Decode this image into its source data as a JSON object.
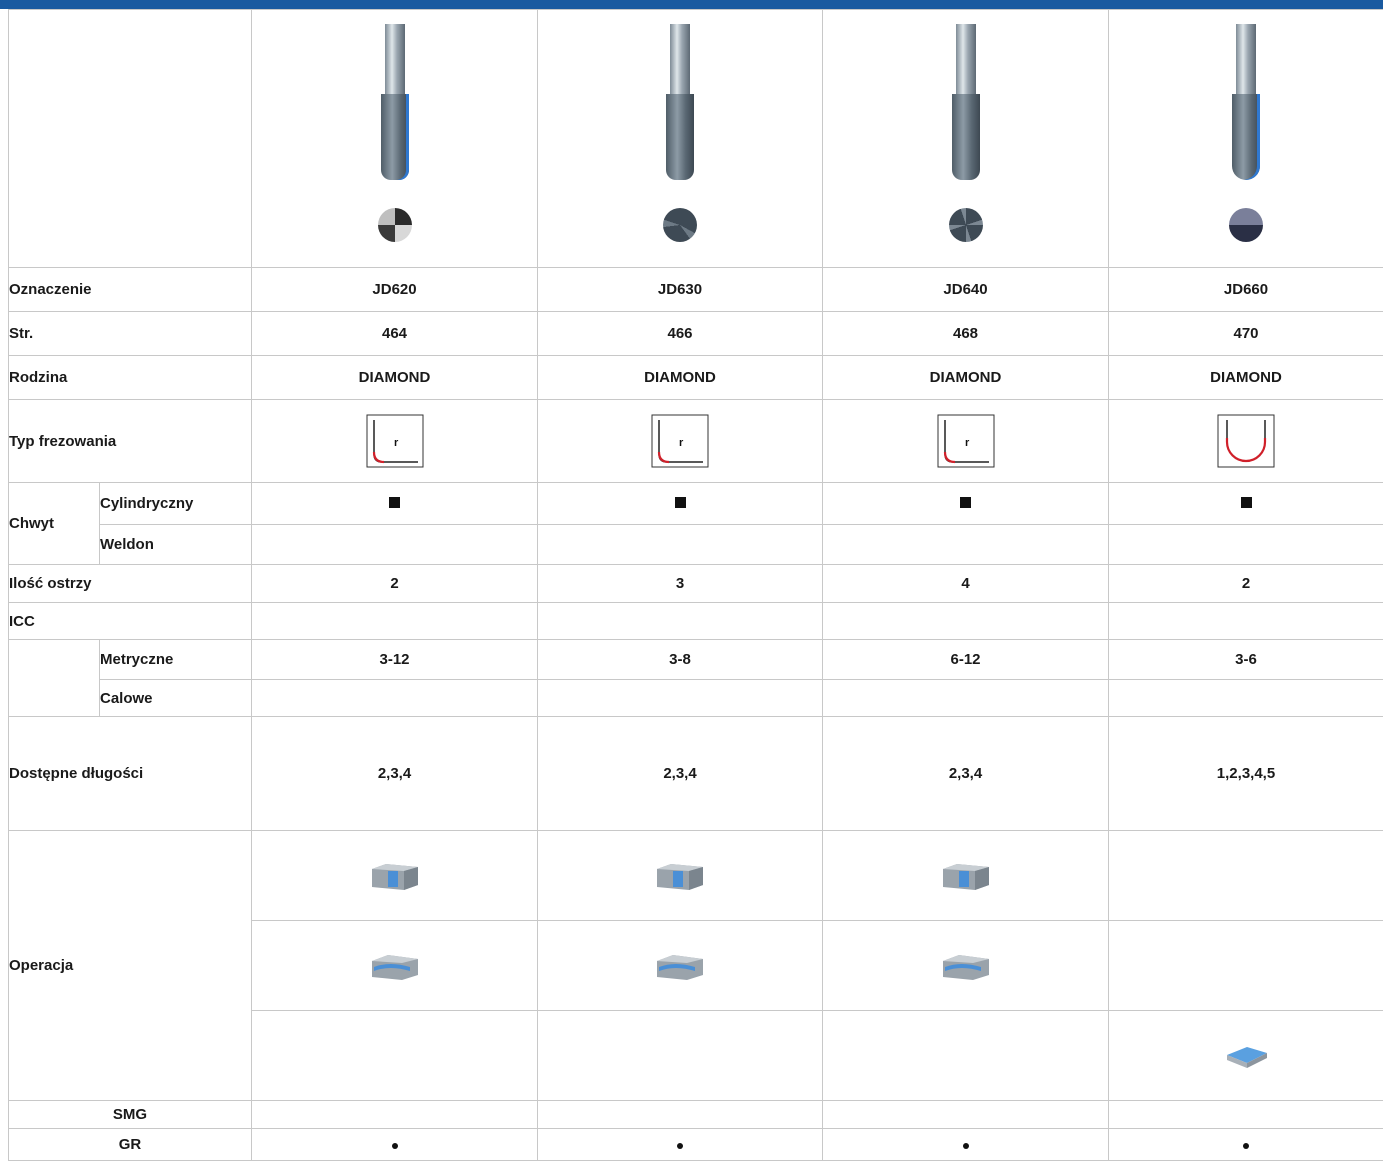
{
  "rows": {
    "designation": {
      "label": "Oznaczenie",
      "values": [
        "JD620",
        "JD630",
        "JD640",
        "JD660"
      ]
    },
    "page": {
      "label": "Str.",
      "values": [
        "464",
        "466",
        "468",
        "470"
      ]
    },
    "family": {
      "label": "Rodzina",
      "values": [
        "DIAMOND",
        "DIAMOND",
        "DIAMOND",
        "DIAMOND"
      ]
    },
    "milling_type": {
      "label": "Typ frezowania",
      "corner_letter": "r"
    },
    "shank": {
      "label": "Chwyt",
      "sub_cylindrical": "Cylindryczny",
      "sub_weldon": "Weldon"
    },
    "flutes": {
      "label": "Ilość ostrzy",
      "values": [
        "2",
        "3",
        "4",
        "2"
      ]
    },
    "icc": {
      "label": "ICC"
    },
    "metric": {
      "label": "Metryczne",
      "values": [
        "3-12",
        "3-8",
        "6-12",
        "3-6"
      ]
    },
    "inch": {
      "label": "Calowe"
    },
    "lengths": {
      "label": "Dostępne długości",
      "values": [
        "2,3,4",
        "2,3,4",
        "2,3,4",
        "1,2,3,4,5"
      ]
    },
    "operation": {
      "label": "Operacja"
    },
    "smg": {
      "label": "SMG"
    },
    "gr": {
      "label": "GR"
    }
  },
  "colors": {
    "header_bar": "#1a5aa0",
    "profile_red": "#d0202a",
    "coating_blue": "#2f78d0"
  },
  "icons": {
    "milling_profile": [
      "corner-radius-profile-icon",
      "corner-radius-profile-icon",
      "corner-radius-profile-icon",
      "ball-nose-profile-icon"
    ],
    "shank_marker": "filled-square",
    "gr_marker": "filled-dot",
    "operation_1": "slotting-operation-icon",
    "operation_2": "profiling-operation-icon",
    "operation_3": "copy-milling-operation-icon"
  }
}
